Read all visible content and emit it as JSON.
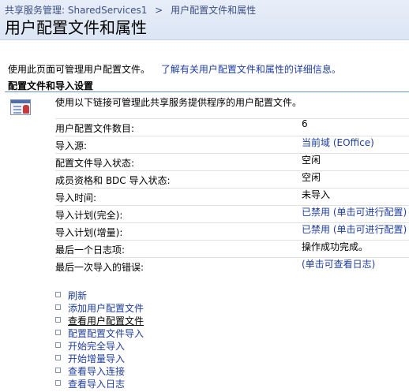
{
  "breadcrumb": {
    "root": "共享服务管理: SharedServices1",
    "separator": ">",
    "current": "用户配置文件和属性"
  },
  "page_title": "用户配置文件和属性",
  "intro": {
    "text": "使用此页面可管理用户配置文件。",
    "link": "了解有关用户配置文件和属性的详细信息。"
  },
  "section": {
    "title": "配置文件和导入设置",
    "icon": "user-profile-settings-icon",
    "description": "使用以下链接可管理此共享服务提供程序的用户配置文件。"
  },
  "properties": [
    {
      "label": "用户配置文件数目:",
      "value": "6"
    },
    {
      "label": "导入源:",
      "value": "当前域 (EOffice)"
    },
    {
      "label": "配置文件导入状态:",
      "value": "空闲"
    },
    {
      "label": "成员资格和 BDC 导入状态:",
      "value": "空闲"
    },
    {
      "label": "导入时间:",
      "value": "未导入"
    },
    {
      "label": "导入计划(完全):",
      "value": "已禁用 (单击可进行配置)"
    },
    {
      "label": "导入计划(增量):",
      "value": "已禁用 (单击可进行配置)"
    },
    {
      "label": "最后一个日志项:",
      "value": "操作成功完成。"
    },
    {
      "label": "最后一次导入的错误:",
      "value": "(单击可查看日志)"
    }
  ],
  "actions": [
    {
      "label": "刷新"
    },
    {
      "label": "添加用户配置文件"
    },
    {
      "label": "查看用户配置文件"
    },
    {
      "label": "配置配置文件导入"
    },
    {
      "label": "开始完全导入"
    },
    {
      "label": "开始增量导入"
    },
    {
      "label": "查看导入连接"
    },
    {
      "label": "查看导入日志"
    }
  ],
  "colors": {
    "link": "#1f3f9f",
    "header_bg": "#dbe5f4",
    "section_rule": "#6f8fbf"
  }
}
